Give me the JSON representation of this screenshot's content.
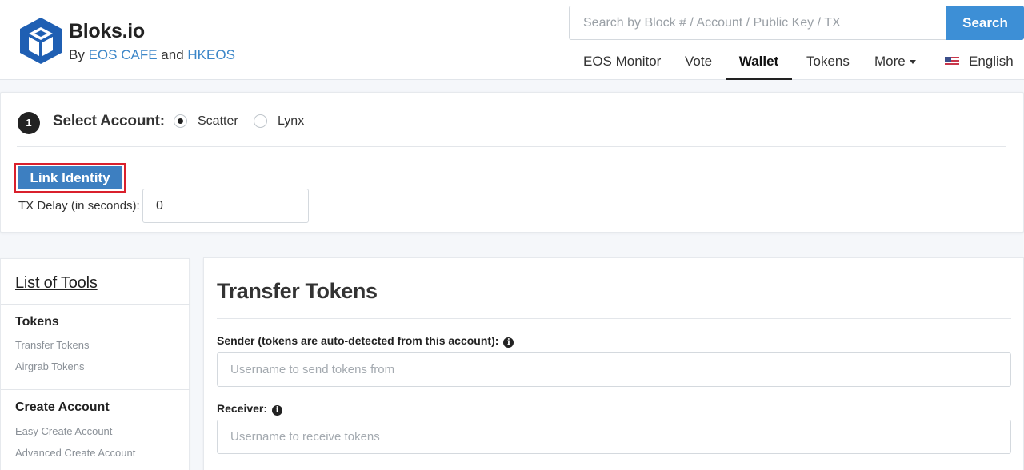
{
  "header": {
    "brand_title": "Bloks.io",
    "brand_by": "By",
    "brand_partner1": "EOS CAFE",
    "brand_and": "and",
    "brand_partner2": "HKEOS",
    "search_placeholder": "Search by Block # / Account / Public Key / TX",
    "search_button": "Search",
    "nav": [
      "EOS Monitor",
      "Vote",
      "Wallet",
      "Tokens",
      "More",
      "English"
    ],
    "active_nav": "Wallet"
  },
  "account": {
    "step_number": "1",
    "select_label": "Select Account:",
    "options": [
      "Scatter",
      "Lynx"
    ],
    "selected": "Scatter",
    "link_button": "Link Identity",
    "delay_label": "TX Delay (in seconds):",
    "delay_value": "0"
  },
  "tools": {
    "title": "List of Tools",
    "sections": [
      {
        "heading": "Tokens",
        "links": [
          "Transfer Tokens",
          "Airgrab Tokens"
        ]
      },
      {
        "heading": "Create Account",
        "links": [
          "Easy Create Account",
          "Advanced Create Account"
        ]
      }
    ]
  },
  "transfer": {
    "title": "Transfer Tokens",
    "sender_label": "Sender (tokens are auto-detected from this account):",
    "sender_placeholder": "Username to send tokens from",
    "receiver_label": "Receiver:",
    "receiver_placeholder": "Username to receive tokens"
  },
  "colors": {
    "accent": "#3d8fd6",
    "link": "#3b86c8",
    "highlight": "#d9202c"
  }
}
